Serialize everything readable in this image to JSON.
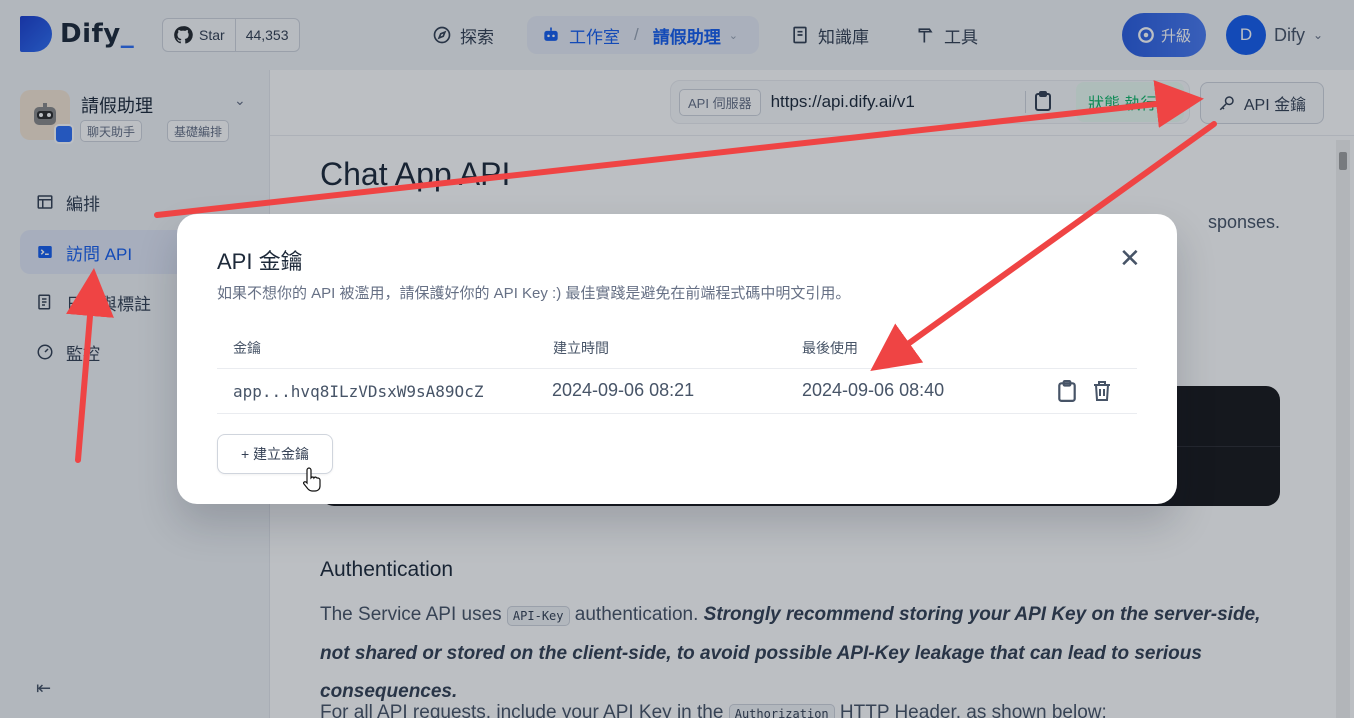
{
  "topbar": {
    "logo_text": "Dify",
    "logo_suffix": "_",
    "star_label": "Star",
    "star_count": "44,353",
    "nav_explore": "探索",
    "nav_studio": "工作室",
    "nav_separator": "/",
    "nav_app": "請假助理",
    "nav_knowledge": "知識庫",
    "nav_tools": "工具",
    "upgrade_label": "升級",
    "user_initial": "D",
    "user_name": "Dify"
  },
  "sidebar": {
    "app_name": "請假助理",
    "tags": [
      "聊天助手",
      "基礎編排"
    ],
    "items": [
      {
        "label": "編排",
        "icon": "layout-icon"
      },
      {
        "label": "訪問 API",
        "icon": "terminal-icon"
      },
      {
        "label": "日誌與標註",
        "icon": "file-list-icon"
      },
      {
        "label": "監控",
        "icon": "dashboard-icon"
      }
    ],
    "active_index": 1
  },
  "main": {
    "api_server_label": "API 伺服器",
    "api_server_url": "https://api.dify.ai/v1",
    "status_text": "狀態 執行中",
    "api_key_button": "API 金鑰",
    "doc_title": "Chat App API",
    "doc_snippet": "sponses.",
    "auth_heading": "Authentication",
    "auth_p_start": "The Service API uses ",
    "auth_code": "API-Key",
    "auth_p_mid": " authentication. ",
    "auth_p_em": "Strongly recommend storing your API Key on the server-side, not shared or stored on the client-side, to avoid possible API-Key leakage that can lead to serious consequences.",
    "auth_p2_start": "For all API requests, include your API Key in the ",
    "auth_p2_code": "Authorization",
    "auth_p2_end": " HTTP Header, as shown below:"
  },
  "modal": {
    "title": "API 金鑰",
    "description": "如果不想你的 API 被濫用，請保護好你的 API Key :) 最佳實踐是避免在前端程式碼中明文引用。",
    "columns": [
      "金鑰",
      "建立時間",
      "最後使用"
    ],
    "rows": [
      {
        "key": "app...hvq8ILzVDsxW9sA89OcZ",
        "created": "2024-09-06 08:21",
        "last_used": "2024-09-06 08:40"
      }
    ],
    "create_button": "+ 建立金鑰"
  },
  "colors": {
    "accent": "#155eef",
    "annotation_arrow": "#ef4444",
    "status_green": "#12b76a"
  }
}
